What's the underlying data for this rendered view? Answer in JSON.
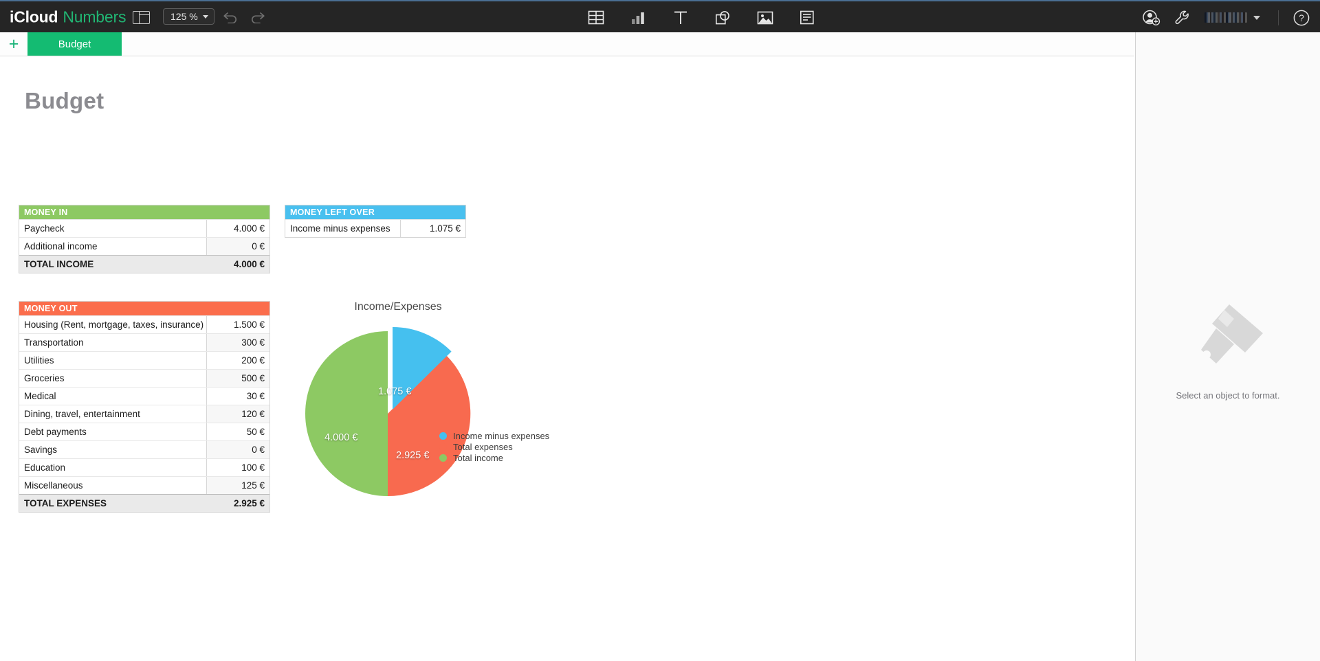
{
  "toolbar": {
    "brand_icloud": "iCloud",
    "brand_app": "Numbers",
    "sidebar_toggle_icon": "window-sidebar-icon",
    "zoom_value": "125 %",
    "undo_icon": "undo-arrow-icon",
    "redo_icon": "redo-arrow-icon",
    "insert_items": [
      {
        "icon": "table-icon",
        "label": "Table"
      },
      {
        "icon": "chart-icon",
        "label": "Chart"
      },
      {
        "icon": "text-icon",
        "label": "Text"
      },
      {
        "icon": "shape-icon",
        "label": "Shape"
      },
      {
        "icon": "image-icon",
        "label": "Image"
      },
      {
        "icon": "comment-icon",
        "label": "Comment"
      }
    ],
    "collaborate_icon": "add-person-icon",
    "tools_icon": "wrench-icon",
    "account_name": "",
    "account_chevron_icon": "chevron-down-icon",
    "help_icon": "help-question-icon",
    "colors": {
      "bar": "#252525",
      "accent_green": "#21b573",
      "top_rule": "#4a6f93"
    }
  },
  "tabbar": {
    "add_sheet_label": "+",
    "tabs": [
      {
        "label": "Budget",
        "active": true
      }
    ],
    "active_color": "#14bb72"
  },
  "document": {
    "title": "Budget"
  },
  "tables": {
    "money_in": {
      "header": "MONEY IN",
      "header_color": "#8dc963",
      "rows": [
        {
          "label": "Paycheck",
          "value": "4.000 €"
        },
        {
          "label": "Additional income",
          "value": "0 €"
        }
      ],
      "total": {
        "label": "TOTAL INCOME",
        "value": "4.000 €"
      }
    },
    "money_left_over": {
      "header": "MONEY LEFT OVER",
      "header_color": "#49c0ef",
      "rows": [
        {
          "label": "Income minus expenses",
          "value": "1.075 €"
        }
      ]
    },
    "money_out": {
      "header": "MONEY OUT",
      "header_color": "#fb6d4c",
      "rows": [
        {
          "label": "Housing (Rent, mortgage, taxes, insurance)",
          "value": "1.500 €"
        },
        {
          "label": "Transportation",
          "value": "300 €"
        },
        {
          "label": "Utilities",
          "value": "200 €"
        },
        {
          "label": "Groceries",
          "value": "500 €"
        },
        {
          "label": "Medical",
          "value": "30 €"
        },
        {
          "label": "Dining, travel, entertainment",
          "value": "120 €"
        },
        {
          "label": "Debt payments",
          "value": "50 €"
        },
        {
          "label": "Savings",
          "value": "0 €"
        },
        {
          "label": "Education",
          "value": "100 €"
        },
        {
          "label": "Miscellaneous",
          "value": "125 €"
        }
      ],
      "total": {
        "label": "TOTAL EXPENSES",
        "value": "2.925 €"
      }
    }
  },
  "chart_data": {
    "type": "pie",
    "title": "Income/Expenses",
    "categories": [
      "Income minus expenses",
      "Total expenses",
      "Total income"
    ],
    "values": [
      1075,
      2925,
      4000
    ],
    "value_labels": [
      "1.075 €",
      "2.925 €",
      "4.000 €"
    ],
    "colors": [
      "#45c0ef",
      "#f86a4f",
      "#8dc963"
    ],
    "exploded": [
      true,
      false,
      false
    ],
    "legend_position": "bottom-right",
    "start_angle_deg": 0,
    "units": "€"
  },
  "format_panel": {
    "empty_icon": "paintbrush-icon",
    "empty_caption": "Select an object to format."
  }
}
